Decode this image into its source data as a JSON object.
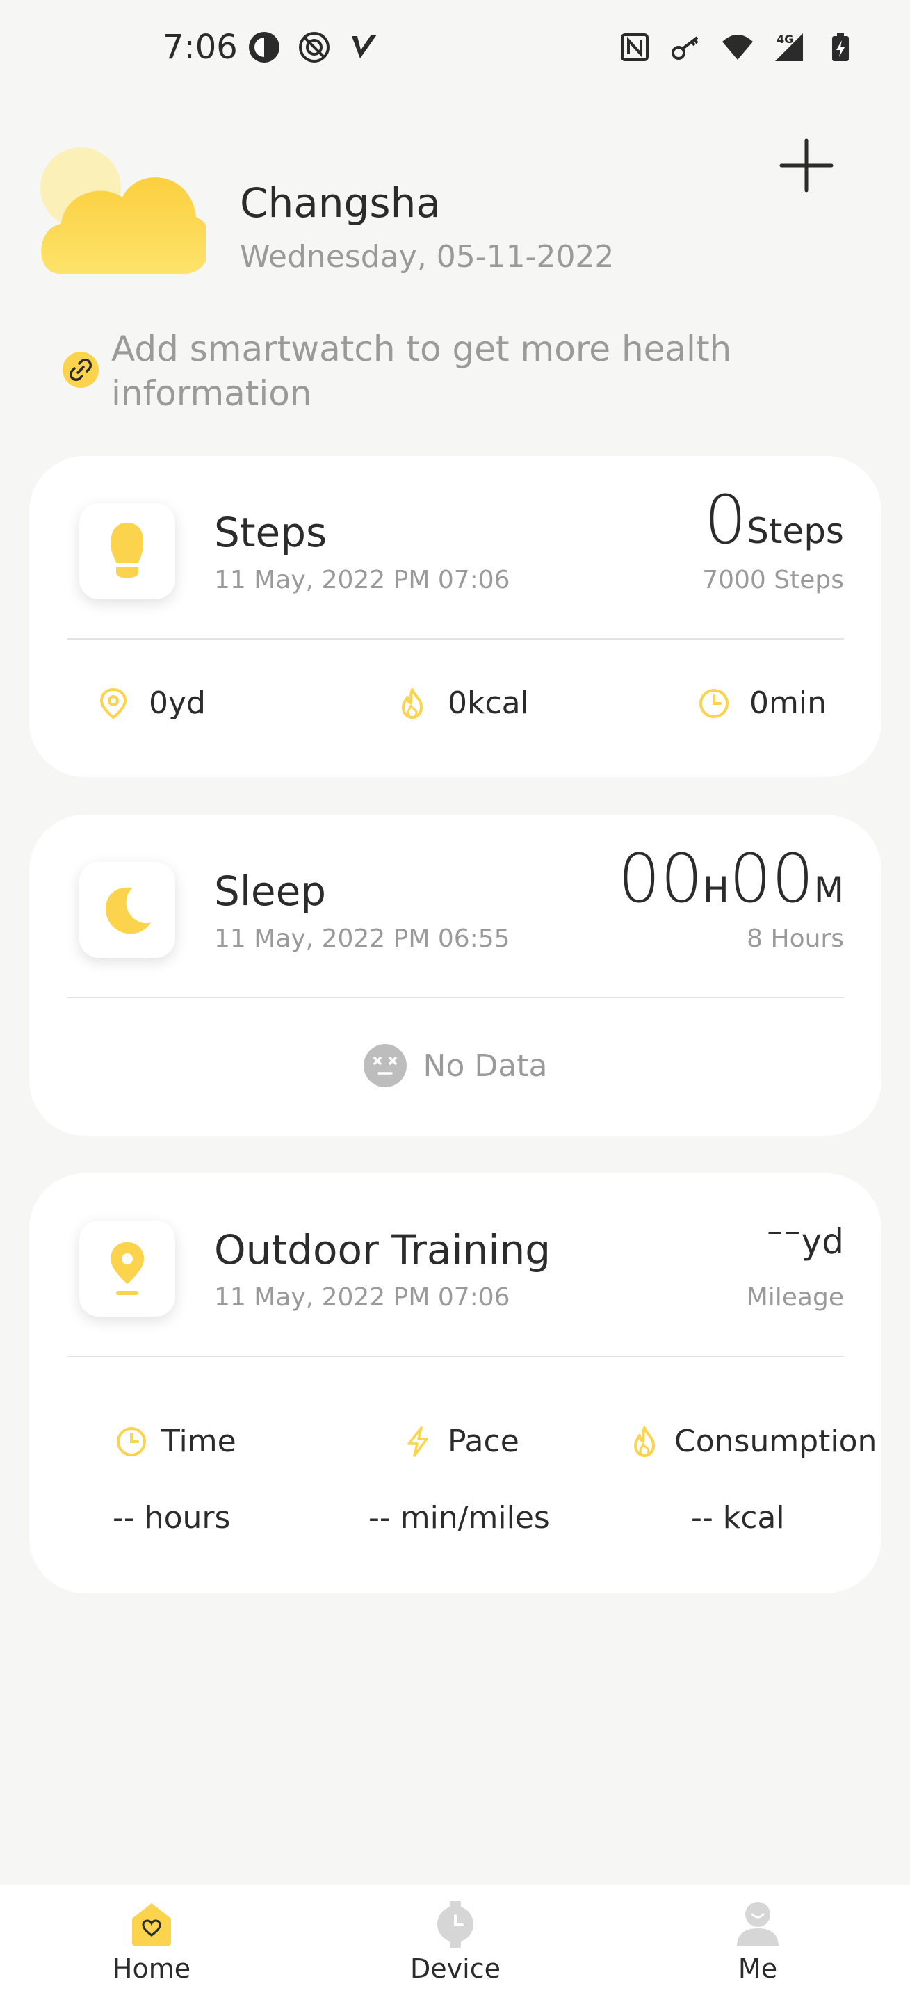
{
  "status_bar": {
    "time": "7:06",
    "left_icons": [
      "pie-circle-icon",
      "crossed-circle-icon",
      "v-logo-icon"
    ],
    "right_icons": [
      "nfc-icon",
      "key-icon",
      "wifi-icon",
      "signal-4g-icon",
      "battery-charging-icon"
    ],
    "network_label": "4G"
  },
  "header": {
    "weather_icon": "cloud-sun-icon",
    "city": "Changsha",
    "date": "Wednesday, 05-11-2022",
    "add_icon": "plus-icon"
  },
  "hint": {
    "icon": "link-icon",
    "text": "Add smartwatch to get more health information"
  },
  "cards": {
    "steps": {
      "icon": "footprint-icon",
      "title": "Steps",
      "timestamp": "11 May, 2022 PM 07:06",
      "value": "0",
      "unit": "Steps",
      "goal": "7000 Steps",
      "stats": {
        "distance": {
          "icon": "location-pin-icon",
          "value": "0yd"
        },
        "calories": {
          "icon": "flame-icon",
          "value": "0kcal"
        },
        "duration": {
          "icon": "clock-icon",
          "value": "0min"
        }
      }
    },
    "sleep": {
      "icon": "moon-icon",
      "title": "Sleep",
      "timestamp": "11 May, 2022 PM 06:55",
      "hours": "00",
      "hours_unit": "H",
      "minutes": "00",
      "minutes_unit": "M",
      "goal": "8 Hours",
      "no_data_icon": "dizzy-face-icon",
      "no_data": "No Data"
    },
    "outdoor": {
      "icon": "map-pin-icon",
      "title": "Outdoor Training",
      "timestamp": "11 May, 2022 PM 07:06",
      "value": "--",
      "unit": "yd",
      "sub": "Mileage",
      "metrics": {
        "time": {
          "icon": "clock-icon",
          "label": "Time",
          "value": "-- hours"
        },
        "pace": {
          "icon": "lightning-icon",
          "label": "Pace",
          "value": "-- min/miles"
        },
        "consumption": {
          "icon": "flame-icon",
          "label": "Consumption",
          "value": "-- kcal"
        }
      }
    }
  },
  "bottom_nav": {
    "items": [
      {
        "icon": "heart-home-icon",
        "label": "Home",
        "active": true
      },
      {
        "icon": "watch-icon",
        "label": "Device",
        "active": false
      },
      {
        "icon": "person-icon",
        "label": "Me",
        "active": false
      }
    ]
  },
  "colors": {
    "accent": "#fcd34d",
    "accent_dark": "#f5c518",
    "background": "#f6f6f4",
    "card": "#ffffff",
    "text_primary": "#2b2b2b",
    "text_secondary": "#9a9a9a"
  }
}
